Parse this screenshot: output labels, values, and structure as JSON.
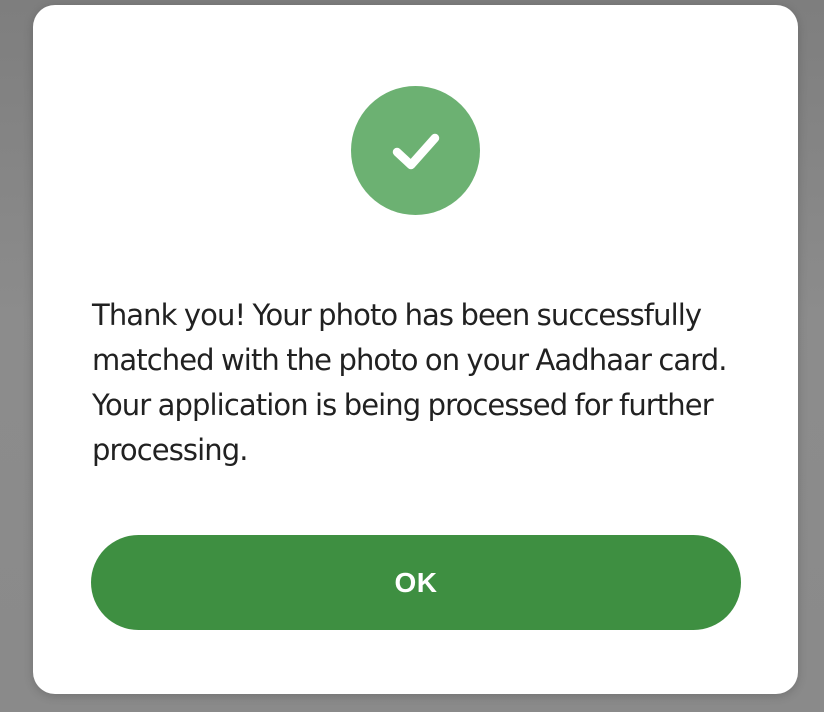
{
  "dialog": {
    "icon": "checkmark-circle-icon",
    "message": "Thank you! Your photo has been successfully matched with the photo on your Aadhaar card. Your application is being processed for further processing.",
    "ok_label": "OK"
  },
  "colors": {
    "icon_circle": "#6cb172",
    "button": "#3e8f41",
    "text": "#212121",
    "backdrop": "#8a8a8a"
  }
}
